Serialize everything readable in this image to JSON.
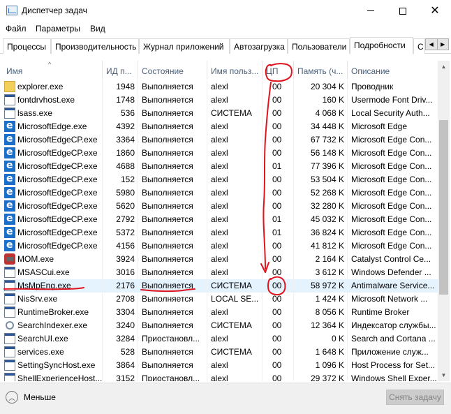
{
  "window": {
    "title": "Диспетчер задач",
    "icon": "task-manager-icon"
  },
  "menu": {
    "items": [
      "Файл",
      "Параметры",
      "Вид"
    ]
  },
  "tabs": {
    "items": [
      "Процессы",
      "Производительность",
      "Журнал приложений",
      "Автозагрузка",
      "Пользователи",
      "Подробности",
      "С"
    ],
    "active": "Подробности"
  },
  "table": {
    "columns": [
      "Имя",
      "ИД п...",
      "Состояние",
      "Имя польз...",
      "ЦП",
      "Память (ч...",
      "Описание"
    ],
    "rows": [
      {
        "icon": "folder",
        "name": "explorer.exe",
        "pid": "1948",
        "state": "Выполняется",
        "user": "alexl",
        "cpu": "00",
        "mem": "20 304 K",
        "desc": "Проводник"
      },
      {
        "icon": "generic",
        "name": "fontdrvhost.exe",
        "pid": "1748",
        "state": "Выполняется",
        "user": "alexl",
        "cpu": "00",
        "mem": "160 K",
        "desc": "Usermode Font Driv..."
      },
      {
        "icon": "generic",
        "name": "lsass.exe",
        "pid": "536",
        "state": "Выполняется",
        "user": "СИСТЕМА",
        "cpu": "00",
        "mem": "4 068 K",
        "desc": "Local Security Auth..."
      },
      {
        "icon": "edge",
        "name": "MicrosoftEdge.exe",
        "pid": "4392",
        "state": "Выполняется",
        "user": "alexl",
        "cpu": "00",
        "mem": "34 448 K",
        "desc": "Microsoft Edge"
      },
      {
        "icon": "edge",
        "name": "MicrosoftEdgeCP.exe",
        "pid": "3364",
        "state": "Выполняется",
        "user": "alexl",
        "cpu": "00",
        "mem": "67 732 K",
        "desc": "Microsoft Edge Con..."
      },
      {
        "icon": "edge",
        "name": "MicrosoftEdgeCP.exe",
        "pid": "1860",
        "state": "Выполняется",
        "user": "alexl",
        "cpu": "00",
        "mem": "56 148 K",
        "desc": "Microsoft Edge Con..."
      },
      {
        "icon": "edge",
        "name": "MicrosoftEdgeCP.exe",
        "pid": "4688",
        "state": "Выполняется",
        "user": "alexl",
        "cpu": "01",
        "mem": "77 396 K",
        "desc": "Microsoft Edge Con..."
      },
      {
        "icon": "edge",
        "name": "MicrosoftEdgeCP.exe",
        "pid": "152",
        "state": "Выполняется",
        "user": "alexl",
        "cpu": "00",
        "mem": "53 504 K",
        "desc": "Microsoft Edge Con..."
      },
      {
        "icon": "edge",
        "name": "MicrosoftEdgeCP.exe",
        "pid": "5980",
        "state": "Выполняется",
        "user": "alexl",
        "cpu": "00",
        "mem": "52 268 K",
        "desc": "Microsoft Edge Con..."
      },
      {
        "icon": "edge",
        "name": "MicrosoftEdgeCP.exe",
        "pid": "5620",
        "state": "Выполняется",
        "user": "alexl",
        "cpu": "00",
        "mem": "32 280 K",
        "desc": "Microsoft Edge Con..."
      },
      {
        "icon": "edge",
        "name": "MicrosoftEdgeCP.exe",
        "pid": "2792",
        "state": "Выполняется",
        "user": "alexl",
        "cpu": "01",
        "mem": "45 032 K",
        "desc": "Microsoft Edge Con..."
      },
      {
        "icon": "edge",
        "name": "MicrosoftEdgeCP.exe",
        "pid": "5372",
        "state": "Выполняется",
        "user": "alexl",
        "cpu": "01",
        "mem": "36 824 K",
        "desc": "Microsoft Edge Con..."
      },
      {
        "icon": "edge",
        "name": "MicrosoftEdgeCP.exe",
        "pid": "4156",
        "state": "Выполняется",
        "user": "alexl",
        "cpu": "00",
        "mem": "41 812 K",
        "desc": "Microsoft Edge Con..."
      },
      {
        "icon": "mom",
        "name": "MOM.exe",
        "pid": "3924",
        "state": "Выполняется",
        "user": "alexl",
        "cpu": "00",
        "mem": "2 164 K",
        "desc": "Catalyst Control Ce..."
      },
      {
        "icon": "generic",
        "name": "MSASCui.exe",
        "pid": "3016",
        "state": "Выполняется",
        "user": "alexl",
        "cpu": "00",
        "mem": "3 612 K",
        "desc": "Windows Defender ..."
      },
      {
        "icon": "generic",
        "name": "MsMpEng.exe",
        "pid": "2176",
        "state": "Выполняется",
        "user": "СИСТЕМА",
        "cpu": "00",
        "mem": "58 972 K",
        "desc": "Antimalware Service...",
        "selected": true
      },
      {
        "icon": "generic",
        "name": "NisSrv.exe",
        "pid": "2708",
        "state": "Выполняется",
        "user": "LOCAL SE...",
        "cpu": "00",
        "mem": "1 424 K",
        "desc": "Microsoft Network ..."
      },
      {
        "icon": "generic",
        "name": "RuntimeBroker.exe",
        "pid": "3304",
        "state": "Выполняется",
        "user": "alexl",
        "cpu": "00",
        "mem": "8 056 K",
        "desc": "Runtime Broker"
      },
      {
        "icon": "search",
        "name": "SearchIndexer.exe",
        "pid": "3240",
        "state": "Выполняется",
        "user": "СИСТЕМА",
        "cpu": "00",
        "mem": "12 364 K",
        "desc": "Индексатор службы..."
      },
      {
        "icon": "generic",
        "name": "SearchUI.exe",
        "pid": "3284",
        "state": "Приостановл...",
        "user": "alexl",
        "cpu": "00",
        "mem": "0 K",
        "desc": "Search and Cortana ..."
      },
      {
        "icon": "generic",
        "name": "services.exe",
        "pid": "528",
        "state": "Выполняется",
        "user": "СИСТЕМА",
        "cpu": "00",
        "mem": "1 648 K",
        "desc": "Приложение служ..."
      },
      {
        "icon": "generic",
        "name": "SettingSyncHost.exe",
        "pid": "3864",
        "state": "Выполняется",
        "user": "alexl",
        "cpu": "00",
        "mem": "1 096 K",
        "desc": "Host Process for Set..."
      },
      {
        "icon": "generic",
        "name": "ShellExperienceHost...",
        "pid": "3152",
        "state": "Приостановл...",
        "user": "alexl",
        "cpu": "00",
        "mem": "29 372 K",
        "desc": "Windows Shell Exper..."
      }
    ]
  },
  "footer": {
    "less_label": "Меньше",
    "end_task_label": "Снять задачу"
  },
  "colors": {
    "header_text": "#4c607a",
    "selected_row": "#e5f3ff",
    "annotation": "#e0141e",
    "disabled_button": "#cccccc"
  }
}
